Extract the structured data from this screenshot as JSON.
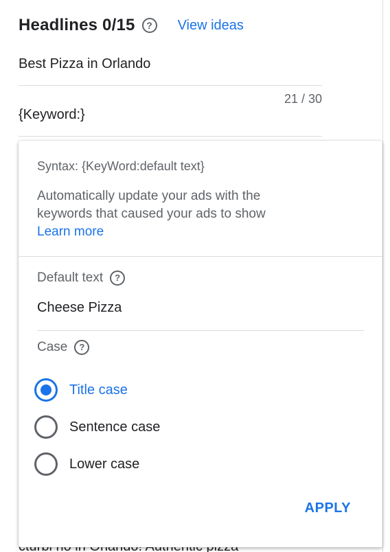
{
  "header": {
    "title": "Headlines 0/15",
    "view_ideas_label": "View ideas"
  },
  "headline_fields": [
    {
      "value": "Best Pizza in Orlando",
      "counter": "21 / 30"
    },
    {
      "value": "{Keyword:}"
    }
  ],
  "keyword_popup": {
    "syntax": "Syntax: {KeyWord:default text}",
    "description": "Automatically update your ads with the keywords that caused your ads to show",
    "learn_more_label": "Learn more",
    "default_text_label": "Default text",
    "default_text_value": "Cheese Pizza",
    "case_label": "Case",
    "case_options": [
      {
        "label": "Title case",
        "selected": true
      },
      {
        "label": "Sentence case",
        "selected": false
      },
      {
        "label": "Lower case",
        "selected": false
      }
    ],
    "apply_label": "APPLY"
  },
  "behind_text": "cturbi no in Orlando! Authentic pizza",
  "colors": {
    "accent": "#1a73e8",
    "text": "#202124",
    "secondary_text": "#5f6368",
    "divider": "#dadce0"
  },
  "icons": {
    "help": "help-circle-icon"
  }
}
